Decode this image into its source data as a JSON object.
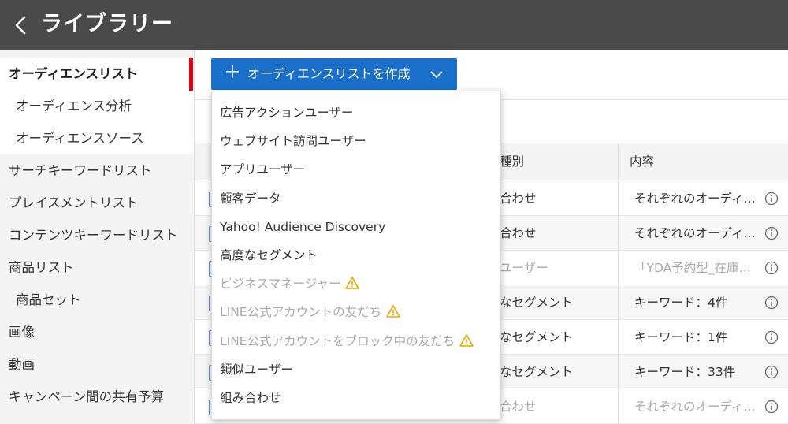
{
  "header": {
    "title": "ライブラリー"
  },
  "sidebar": {
    "items": [
      {
        "label": "オーディエンスリスト"
      },
      {
        "label": "オーディエンス分析"
      },
      {
        "label": "オーディエンスソース"
      },
      {
        "label": "サーチキーワードリスト"
      },
      {
        "label": "プレイスメントリスト"
      },
      {
        "label": "コンテンツキーワードリスト"
      },
      {
        "label": "商品リスト"
      },
      {
        "label": "商品セット"
      },
      {
        "label": "画像"
      },
      {
        "label": "動画"
      },
      {
        "label": "キャンペーン間の共有予算"
      }
    ],
    "active": "オーディエンスリスト"
  },
  "main": {
    "create_button": {
      "label": "オーディエンスリストを作成"
    },
    "table": {
      "headers": {
        "type": "種別",
        "content": "内容"
      },
      "rows": [
        {
          "type": "合わせ",
          "content": "それぞれのオーディ…",
          "dim": false
        },
        {
          "type": "合わせ",
          "content": "それぞれのオーディ…",
          "dim": false
        },
        {
          "type": "ユーザー",
          "content": "「YDA予約型_在庫…",
          "dim": true
        },
        {
          "type": "なセグメント",
          "content": "キーワード：4件",
          "dim": false
        },
        {
          "type": "なセグメント",
          "content": "キーワード：1件",
          "dim": false
        },
        {
          "type": "なセグメント",
          "content": "キーワード：33件",
          "dim": false
        },
        {
          "type": "合わせ",
          "content": "それぞれのオーディ…",
          "dim": true
        }
      ]
    }
  },
  "dropdown": {
    "items": [
      {
        "label": "広告アクションユーザー",
        "disabled": false,
        "warning": false
      },
      {
        "label": "ウェブサイト訪問ユーザー",
        "disabled": false,
        "warning": false
      },
      {
        "label": "アプリユーザー",
        "disabled": false,
        "warning": false
      },
      {
        "label": "顧客データ",
        "disabled": false,
        "warning": false
      },
      {
        "label": "Yahoo! Audience Discovery",
        "disabled": false,
        "warning": false
      },
      {
        "label": "高度なセグメント",
        "disabled": false,
        "warning": false
      },
      {
        "label": "ビジネスマネージャー",
        "disabled": true,
        "warning": true
      },
      {
        "label": "LINE公式アカウントの友だち",
        "disabled": true,
        "warning": true
      },
      {
        "label": "LINE公式アカウントをブロック中の友だち",
        "disabled": true,
        "warning": true
      },
      {
        "label": "類似ユーザー",
        "disabled": false,
        "warning": false
      },
      {
        "label": "組み合わせ",
        "disabled": false,
        "warning": false
      }
    ]
  },
  "colors": {
    "header_bg": "#4a4a4a",
    "accent": "#1a6fc9",
    "active_marker": "#e60012",
    "warning": "#f0a500"
  }
}
